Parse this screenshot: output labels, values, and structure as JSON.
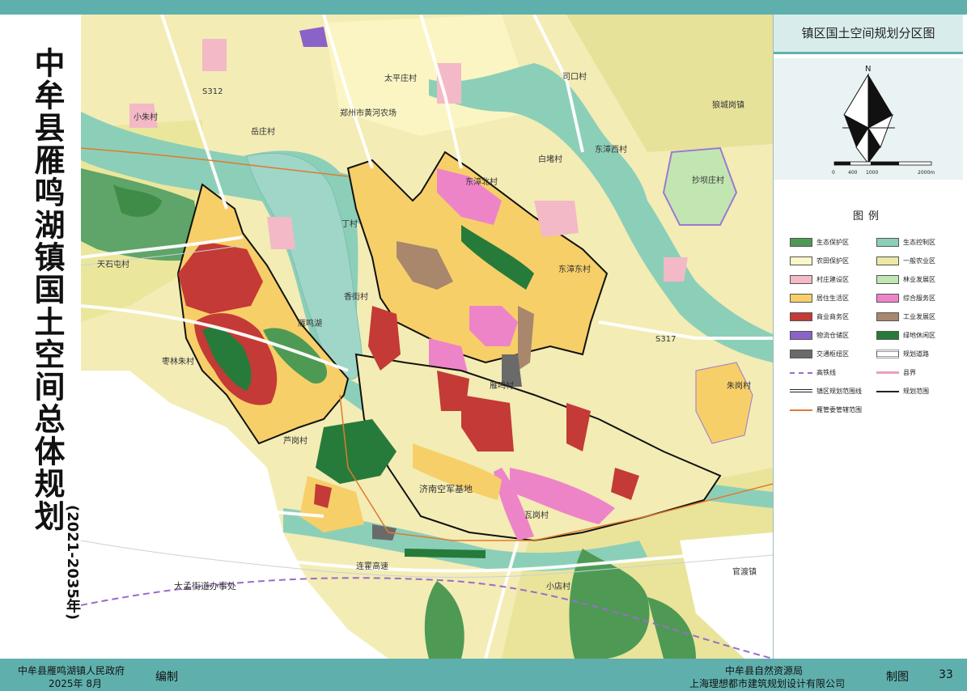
{
  "title": "中牟县雁鸣湖镇国土空间总体规划",
  "title_years": "(2021-2035年)",
  "panel_title": "镇区国土空间规划分区图",
  "compass": {
    "north": "N",
    "scale_ticks": [
      "0",
      "400",
      "1000",
      "2000m"
    ]
  },
  "legend_title": "图例",
  "legend": [
    {
      "label": "生态保护区",
      "color": "#4e9a55",
      "style": "fill"
    },
    {
      "label": "生态控制区",
      "color": "#8ccfb8",
      "style": "fill"
    },
    {
      "label": "农田保护区",
      "color": "#fbf7c8",
      "style": "fill"
    },
    {
      "label": "一般农业区",
      "color": "#ece9a4",
      "style": "fill"
    },
    {
      "label": "村庄建设区",
      "color": "#f3b9c6",
      "style": "fill"
    },
    {
      "label": "林业发展区",
      "color": "#c2e6b2",
      "style": "fill"
    },
    {
      "label": "居住生活区",
      "color": "#f7cf68",
      "style": "fill"
    },
    {
      "label": "综合服务区",
      "color": "#ee84c8",
      "style": "fill"
    },
    {
      "label": "商业商务区",
      "color": "#c33a36",
      "style": "fill"
    },
    {
      "label": "工业发展区",
      "color": "#a8876d",
      "style": "fill"
    },
    {
      "label": "物流仓储区",
      "color": "#8a62c8",
      "style": "fill"
    },
    {
      "label": "绿地休闲区",
      "color": "#267b3a",
      "style": "fill"
    },
    {
      "label": "交通枢纽区",
      "color": "#6a6a6a",
      "style": "fill"
    },
    {
      "label": "规划道路",
      "color": "#ffffff",
      "style": "road"
    },
    {
      "label": "高铁线",
      "color": "#9a6cc8",
      "style": "dash"
    },
    {
      "label": "县界",
      "color": "#e8a0c0",
      "style": "county"
    },
    {
      "label": "镇区规划范围线",
      "color": "#222222",
      "style": "double"
    },
    {
      "label": "规划范围",
      "color": "#222222",
      "style": "plan"
    },
    {
      "label": "雁管委管辖范围",
      "color": "#e07a2e",
      "style": "orange"
    }
  ],
  "map_labels": {
    "taiping": "太平庄村",
    "sikou": "司口村",
    "langcheng": "狼城岗镇",
    "xiaozhu": "小朱村",
    "zhengzhou_farm": "郑州市黄河农场",
    "yuezhuang": "岳庄村",
    "baijie": "白堵村",
    "dongzhangxi": "东漳西村",
    "chaobazhuang": "抄坝庄村",
    "dongzhangbei": "东漳北村",
    "dongzhangdong": "东漳东村",
    "diancheng": "",
    "dingcun": "丁村",
    "dashi": "天石屯村",
    "xiangjie": "香街村",
    "yanminghu": "雁鸣湖",
    "zaolin": "枣林朱村",
    "zhugang": "朱岗村",
    "yanming": "雁鸣村",
    "lugang": "芦岗村",
    "jinan_base": "济南空军基地",
    "gugang": "瓦岗村",
    "guandu": "官渡镇",
    "xiaoyan": "小店村",
    "dameng": "大孟街道办事处",
    "lianhuo": "连霍高速",
    "road_s312": "S312",
    "road_s317": "S317"
  },
  "footer": {
    "gov": "中牟县雁鸣湖镇人民政府",
    "date": "2025年  8月",
    "compile": "编制",
    "bureau": "中牟县自然资源局",
    "institute": "上海理想都市建筑规划设计有限公司",
    "draw": "制图",
    "page": "33"
  }
}
